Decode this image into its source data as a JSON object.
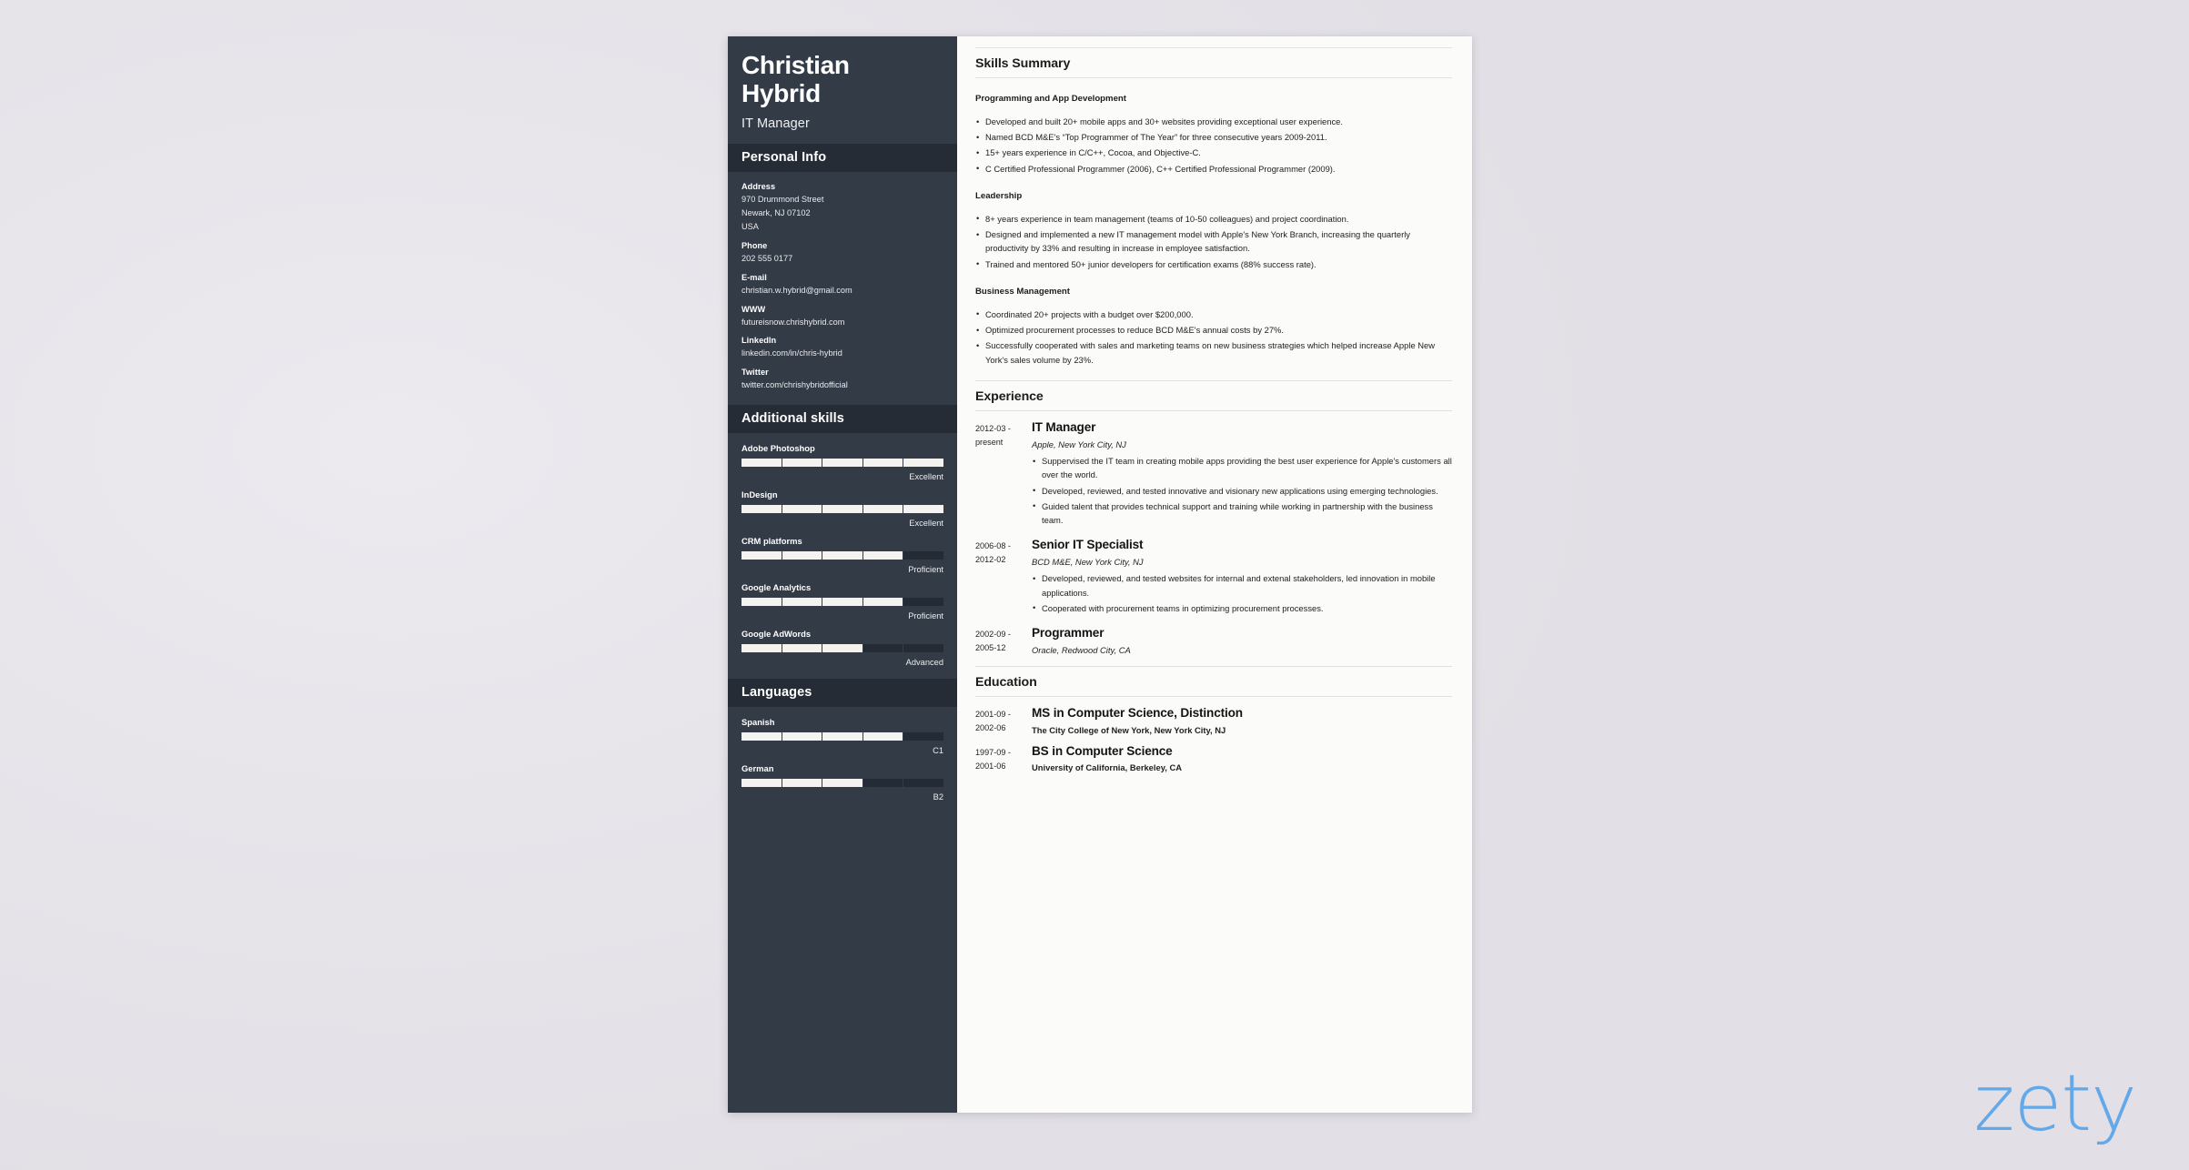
{
  "colors": {
    "sidebar_bg": "#333b47",
    "sidebar_head_bg": "#252c36",
    "page_bg": "#fbfbf9",
    "backdrop": "#e8e6ea",
    "watermark_blue": "#63a8e8",
    "bar_fill": "#f4f3ef"
  },
  "header": {
    "first_name": "Christian",
    "last_name": "Hybrid",
    "job_title": "IT Manager"
  },
  "personal_info": {
    "section_title": "Personal Info",
    "rows": [
      {
        "label": "Address",
        "lines": [
          "970 Drummond Street",
          "Newark, NJ 07102",
          "USA"
        ]
      },
      {
        "label": "Phone",
        "lines": [
          "202 555 0177"
        ]
      },
      {
        "label": "E-mail",
        "lines": [
          "christian.w.hybrid@gmail.com"
        ]
      },
      {
        "label": "WWW",
        "lines": [
          "futureisnow.chrishybrid.com"
        ]
      },
      {
        "label": "LinkedIn",
        "lines": [
          "linkedin.com/in/chris-hybrid"
        ]
      },
      {
        "label": "Twitter",
        "lines": [
          "twitter.com/chrishybridofficial"
        ]
      }
    ]
  },
  "additional_skills": {
    "section_title": "Additional skills",
    "items": [
      {
        "name": "Adobe Photoshop",
        "level": "Excellent",
        "percent": 100
      },
      {
        "name": "InDesign",
        "level": "Excellent",
        "percent": 100
      },
      {
        "name": "CRM platforms",
        "level": "Proficient",
        "percent": 80
      },
      {
        "name": "Google Analytics",
        "level": "Proficient",
        "percent": 80
      },
      {
        "name": "Google AdWords",
        "level": "Advanced",
        "percent": 60
      }
    ]
  },
  "languages": {
    "section_title": "Languages",
    "items": [
      {
        "name": "Spanish",
        "level": "C1",
        "percent": 80
      },
      {
        "name": "German",
        "level": "B2",
        "percent": 60
      }
    ]
  },
  "skills_summary": {
    "section_title": "Skills Summary",
    "groups": [
      {
        "heading": "Programming and App Development",
        "bullets": [
          "Developed and built 20+ mobile apps and 30+ websites providing exceptional user experience.",
          "Named BCD M&E's “Top Programmer of The Year” for three consecutive years 2009-2011.",
          "15+ years experience in C/C++, Cocoa, and Objective-C.",
          "C Certified Professional Programmer (2006), C++ Certified Professional Programmer (2009)."
        ]
      },
      {
        "heading": "Leadership",
        "bullets": [
          "8+ years experience in team management (teams of 10-50 colleagues) and project coordination.",
          "Designed and implemented a new IT management model with Apple's New York Branch, increasing the quarterly productivity by 33% and resulting in increase in employee satisfaction.",
          "Trained and mentored 50+ junior developers for certification exams (88% success rate)."
        ]
      },
      {
        "heading": "Business Management",
        "bullets": [
          "Coordinated 20+ projects with a budget over $200,000.",
          "Optimized procurement processes to reduce BCD M&E's annual costs by 27%.",
          "Successfully cooperated with sales and marketing teams on new business strategies which helped increase Apple New York's sales volume by 23%."
        ]
      }
    ]
  },
  "experience": {
    "section_title": "Experience",
    "entries": [
      {
        "date_from": "2012-03 -",
        "date_to": "present",
        "title": "IT Manager",
        "organization": "Apple, New York City, NJ",
        "bullets": [
          "Suppervised the IT team in creating mobile apps providing the best user experience for Apple's customers all over the world.",
          "Developed, reviewed, and tested innovative and visionary new applications using emerging technologies.",
          "Guided talent that provides technical support and training while working in partnership with the business team."
        ]
      },
      {
        "date_from": "2006-08 -",
        "date_to": "2012-02",
        "title": "Senior IT Specialist",
        "organization": "BCD M&E, New York City, NJ",
        "bullets": [
          "Developed, reviewed, and tested websites for internal and extenal stakeholders, led innovation in mobile applications.",
          "Cooperated with procurement teams in optimizing procurement processes."
        ]
      },
      {
        "date_from": "2002-09 -",
        "date_to": "2005-12",
        "title": "Programmer",
        "organization": "Oracle, Redwood City, CA",
        "bullets": []
      }
    ]
  },
  "education": {
    "section_title": "Education",
    "entries": [
      {
        "date_from": "2001-09 -",
        "date_to": "2002-06",
        "title": "MS in Computer Science, Distinction",
        "organization": "The City College of New York, New York City, NJ"
      },
      {
        "date_from": "1997-09 -",
        "date_to": "2001-06",
        "title": "BS in Computer Science",
        "organization": "University of California, Berkeley, CA"
      }
    ]
  },
  "watermark": {
    "text": "zety"
  }
}
